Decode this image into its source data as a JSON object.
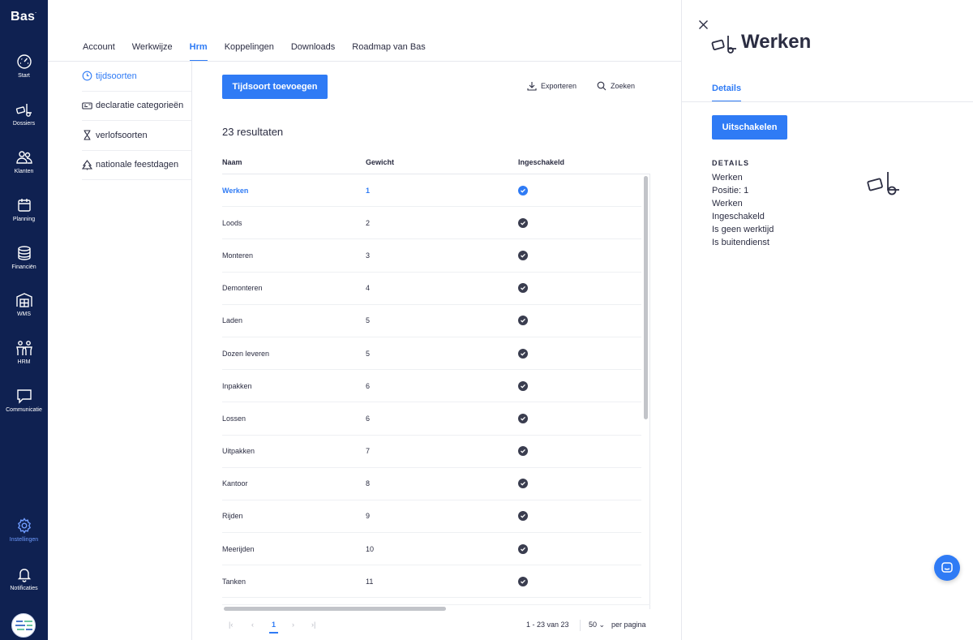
{
  "brand": {
    "logo": "Bas",
    "logo_mark": "."
  },
  "nav": {
    "items": [
      {
        "label": "Start",
        "icon": "gauge-icon"
      },
      {
        "label": "Dossiers",
        "icon": "dolly-icon"
      },
      {
        "label": "Klanten",
        "icon": "users-icon"
      },
      {
        "label": "Planning",
        "icon": "calendar-icon"
      },
      {
        "label": "Financiën",
        "icon": "coins-icon"
      },
      {
        "label": "WMS",
        "icon": "warehouse-icon"
      },
      {
        "label": "HRM",
        "icon": "team-icon"
      },
      {
        "label": "Communicatie",
        "icon": "chat-icon"
      },
      {
        "label": "Instellingen",
        "icon": "gear-icon",
        "active": true
      },
      {
        "label": "Notificaties",
        "icon": "bell-icon"
      }
    ]
  },
  "tabs": [
    {
      "label": "Account"
    },
    {
      "label": "Werkwijze"
    },
    {
      "label": "Hrm",
      "active": true
    },
    {
      "label": "Koppelingen"
    },
    {
      "label": "Downloads"
    },
    {
      "label": "Roadmap van Bas"
    }
  ],
  "submenu": [
    {
      "label": "tijdsoorten",
      "icon": "clock-icon",
      "active": true
    },
    {
      "label": "declaratie categorieën",
      "icon": "receipt-icon"
    },
    {
      "label": "verlofsoorten",
      "icon": "hourglass-icon"
    },
    {
      "label": "nationale feestdagen",
      "icon": "tree-icon"
    }
  ],
  "toolbar": {
    "add_label": "Tijdsoort toevoegen",
    "export_label": "Exporteren",
    "search_label": "Zoeken"
  },
  "results_label": "23 resultaten",
  "table": {
    "columns": [
      "Naam",
      "Gewicht",
      "Ingeschakeld"
    ],
    "rows": [
      {
        "name": "Werken",
        "weight": "1",
        "active": true
      },
      {
        "name": "Loods",
        "weight": "2"
      },
      {
        "name": "Monteren",
        "weight": "3"
      },
      {
        "name": "Demonteren",
        "weight": "4"
      },
      {
        "name": "Laden",
        "weight": "5"
      },
      {
        "name": "Dozen leveren",
        "weight": "5"
      },
      {
        "name": "Inpakken",
        "weight": "6"
      },
      {
        "name": "Lossen",
        "weight": "6"
      },
      {
        "name": "Uitpakken",
        "weight": "7"
      },
      {
        "name": "Kantoor",
        "weight": "8"
      },
      {
        "name": "Rijden",
        "weight": "9"
      },
      {
        "name": "Meerijden",
        "weight": "10"
      },
      {
        "name": "Tanken",
        "weight": "11"
      }
    ]
  },
  "pagination": {
    "current_page": "1",
    "range": "1 - 23 van 23",
    "per_page": "50",
    "per_page_label": "per pagina"
  },
  "panel": {
    "title": "Werken",
    "tab": "Details",
    "disable_label": "Uitschakelen",
    "details_heading": "DETAILS",
    "details": [
      "Werken",
      "Positie: 1",
      "Werken",
      "Ingeschakeld",
      "Is geen werktijd",
      "Is buitendienst"
    ]
  },
  "colors": {
    "nav_bg": "#0f2151",
    "accent": "#2f7bf5",
    "text": "#2b2d42"
  }
}
